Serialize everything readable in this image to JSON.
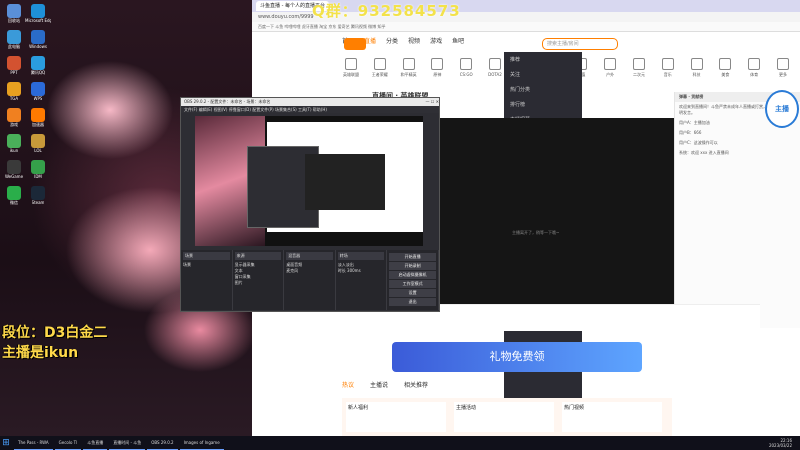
{
  "watermark": {
    "qq": "Q群：932584573"
  },
  "stream_overlay": {
    "line1": "段位：D3白金二",
    "line2": "主播是ikun"
  },
  "desktop_icons": [
    {
      "label": "回收站",
      "color": "#5a8fd8"
    },
    {
      "label": "Microsoft Edge",
      "color": "#1e90d8"
    },
    {
      "label": "此电脑",
      "color": "#3a9ad9"
    },
    {
      "label": "Windows",
      "color": "#2a6cc8"
    },
    {
      "label": "PPT",
      "color": "#d35230"
    },
    {
      "label": "腾讯QQ",
      "color": "#2a9de0"
    },
    {
      "label": "TGA",
      "color": "#e8a020"
    },
    {
      "label": "WPS",
      "color": "#2b6ad8"
    },
    {
      "label": "游戏",
      "color": "#f08020"
    },
    {
      "label": "加速器",
      "color": "#ff7a00"
    },
    {
      "label": "ikun",
      "color": "#4ab05a"
    },
    {
      "label": "LOL",
      "color": "#c89a3a"
    },
    {
      "label": "WeGame",
      "color": "#3a3a3a"
    },
    {
      "label": "IDM",
      "color": "#35a04a"
    },
    {
      "label": "微信",
      "color": "#2aae4a"
    },
    {
      "label": "Steam",
      "color": "#1b2838"
    }
  ],
  "browser": {
    "tab": "斗鱼直播 - 每个人的直播平台",
    "address": "www.douyu.com/9999",
    "bookmarks": "百度一下  斗鱼  哔哩哔哩  虎牙直播  淘宝  京东  爱奇艺  腾讯视频  微博  知乎",
    "nav": [
      "首页",
      "直播",
      "分类",
      "视频",
      "游戏",
      "鱼吧"
    ],
    "search_placeholder": "搜索主播/房间",
    "categories": [
      "英雄联盟",
      "王者荣耀",
      "和平精英",
      "原神",
      "CS:GO",
      "DOTA2",
      "主机游戏",
      "绝地求生",
      "颜值",
      "户外",
      "二次元",
      "音乐",
      "科技",
      "美食",
      "体育",
      "更多"
    ],
    "room_title": "直播间 · 英雄联盟",
    "video_caption": "主播离开了，稍等一下哦~",
    "chat_header": "弹幕 · 贡献榜",
    "chat_lines": [
      "欢迎来到直播间！斗鱼严禁未成年人直播或打赏，请理性消费，文明发言。",
      "用户A：主播加油",
      "用户B：666",
      "用户C：这波操作可以",
      "系统：欢迎 xxx 进入直播间"
    ],
    "left_menu": [
      "推荐",
      "关注",
      "热门分类",
      "排行榜",
      "主播招募",
      "游戏中心"
    ],
    "banner": "礼物免费领",
    "lower_tabs": [
      "热议",
      "主播说",
      "相关推荐"
    ],
    "cards": [
      "新人福利",
      "主播活动",
      "热门视频"
    ]
  },
  "obs": {
    "title": "OBS 29.0.2 - 配置文件：未命名 - 场景：未命名",
    "menu": "文件(F)  编辑(E)  视图(V)  停靠窗口(D)  配置文件(P)  场景集合(S)  工具(T)  帮助(H)",
    "docks": [
      {
        "header": "场景",
        "items": [
          "场景"
        ]
      },
      {
        "header": "来源",
        "items": [
          "显示器采集",
          "文本",
          "窗口采集",
          "图片"
        ]
      },
      {
        "header": "混音器",
        "items": [
          "桌面音频",
          "麦克风"
        ]
      },
      {
        "header": "转场",
        "items": [
          "淡入淡出",
          "时长 300ms"
        ]
      }
    ],
    "controls": [
      "开始直播",
      "开始录制",
      "启动虚拟摄像机",
      "工作室模式",
      "设置",
      "退出"
    ]
  },
  "taskbar": {
    "items": [
      "The Pass - RWA",
      "Gecolo Tl",
      "斗鱼直播",
      "直播时间 - 斗鱼",
      "OBS 29.0.2",
      "Images of Ingame"
    ],
    "time": "22:16",
    "date": "2023/03/22"
  },
  "mascot": "主播"
}
